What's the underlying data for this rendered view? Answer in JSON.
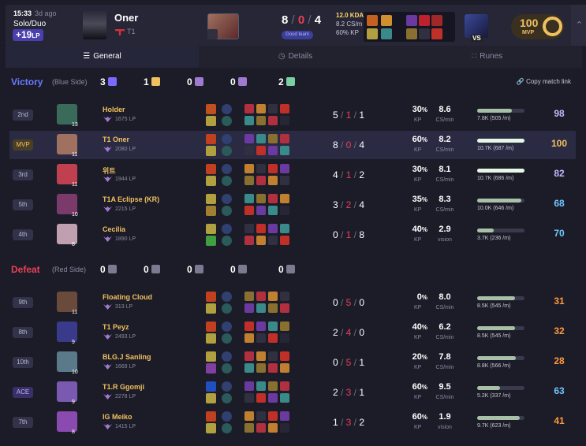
{
  "header": {
    "time": "15:33",
    "ago": "3d ago",
    "queue": "Solo/Duo",
    "lp_change": "+19",
    "lp_unit": "LP",
    "player_name": "Oner",
    "team": "T1",
    "kills": "8",
    "deaths": "0",
    "assists": "4",
    "badge": "Good team",
    "kda_ratio": "12.0 KDA",
    "cs_per_min": "8.2 CS/m",
    "kp": "60% KP",
    "vs_label": "VS",
    "mvp_score": "100",
    "mvp_label": "MVP"
  },
  "tabs": [
    {
      "label": "General",
      "icon": "list-icon"
    },
    {
      "label": "Details",
      "icon": "clock-icon"
    },
    {
      "label": "Runes",
      "icon": "grid-icon"
    }
  ],
  "copy_link": "Copy match link",
  "teams": [
    {
      "result": "Victory",
      "side": "(Blue Side)",
      "result_color": "#6a7aff",
      "objectives": [
        "3",
        "1",
        "0",
        "0",
        "2"
      ],
      "players": [
        {
          "place": "2nd",
          "name": "Holder",
          "lp": "1675 LP",
          "level": "13",
          "k": "5",
          "d": "1",
          "a": "1",
          "kp": "30",
          "cs": "8.6",
          "cs_label": "CS/min",
          "dmg": "7.8K (505 /m)",
          "dmg_pct": 0.73,
          "score": "98",
          "score_color": "#c0b8ff"
        },
        {
          "place": "MVP",
          "name": "T1 Oner",
          "lp": "2080 LP",
          "level": "11",
          "k": "8",
          "d": "0",
          "a": "4",
          "kp": "60",
          "cs": "8.2",
          "cs_label": "CS/min",
          "dmg": "10.7K (687 /m)",
          "dmg_pct": 1.0,
          "score": "100",
          "score_color": "#f0c060"
        },
        {
          "place": "3rd",
          "name": "위트",
          "lp": "1944 LP",
          "level": "11",
          "k": "4",
          "d": "1",
          "a": "2",
          "kp": "30",
          "cs": "8.1",
          "cs_label": "CS/min",
          "dmg": "10.7K (686 /m)",
          "dmg_pct": 1.0,
          "score": "82",
          "score_color": "#c0b8ff"
        },
        {
          "place": "5th",
          "name": "T1A Eclipse (KR)",
          "lp": "2215 LP",
          "level": "10",
          "k": "3",
          "d": "2",
          "a": "4",
          "kp": "35",
          "cs": "8.3",
          "cs_label": "CS/min",
          "dmg": "10.0K (646 /m)",
          "dmg_pct": 0.93,
          "score": "68",
          "score_color": "#6fc8ff"
        },
        {
          "place": "4th",
          "name": "Cecilia",
          "lp": "1890 LP",
          "level": "8",
          "k": "0",
          "d": "1",
          "a": "8",
          "kp": "40",
          "cs": "2.9",
          "cs_label": "vision",
          "dmg": "3.7K (236 /m)",
          "dmg_pct": 0.35,
          "score": "70",
          "score_color": "#6fc8ff"
        }
      ]
    },
    {
      "result": "Defeat",
      "side": "(Red Side)",
      "result_color": "#e84057",
      "objectives": [
        "0",
        "0",
        "0",
        "0",
        "0"
      ],
      "players": [
        {
          "place": "9th",
          "name": "Floating Cloud",
          "lp": "313 LP",
          "level": "11",
          "k": "0",
          "d": "5",
          "a": "0",
          "kp": "0",
          "cs": "8.0",
          "cs_label": "CS/min",
          "dmg": "8.5K (545 /m)",
          "dmg_pct": 0.8,
          "score": "31",
          "score_color": "#ff9a3c"
        },
        {
          "place": "8th",
          "name": "T1 Peyz",
          "lp": "2493 LP",
          "level": "9",
          "k": "2",
          "d": "4",
          "a": "0",
          "kp": "40",
          "cs": "6.2",
          "cs_label": "CS/min",
          "dmg": "8.5K (545 /m)",
          "dmg_pct": 0.8,
          "score": "32",
          "score_color": "#ff9a3c"
        },
        {
          "place": "10th",
          "name": "BLG.J Sanling",
          "lp": "1669 LP",
          "level": "10",
          "k": "0",
          "d": "5",
          "a": "1",
          "kp": "20",
          "cs": "7.8",
          "cs_label": "CS/min",
          "dmg": "8.8K (566 /m)",
          "dmg_pct": 0.82,
          "score": "28",
          "score_color": "#ff9a3c"
        },
        {
          "place": "ACE",
          "name": "T1.R Ggomji",
          "lp": "2278 LP",
          "level": "9",
          "k": "2",
          "d": "3",
          "a": "1",
          "kp": "60",
          "cs": "9.5",
          "cs_label": "CS/min",
          "dmg": "5.2K (337 /m)",
          "dmg_pct": 0.49,
          "score": "63",
          "score_color": "#6fc8ff"
        },
        {
          "place": "7th",
          "name": "IG Meiko",
          "lp": "1415 LP",
          "level": "8",
          "k": "1",
          "d": "3",
          "a": "2",
          "kp": "60",
          "cs": "1.9",
          "cs_label": "vision",
          "dmg": "9.7K (623 /m)",
          "dmg_pct": 0.9,
          "score": "41",
          "score_color": "#ff9a3c"
        }
      ]
    }
  ],
  "kp_label": "KP",
  "colors": {
    "accent": "#4a3fae",
    "death": "#e84057",
    "gold": "#f0c060"
  }
}
